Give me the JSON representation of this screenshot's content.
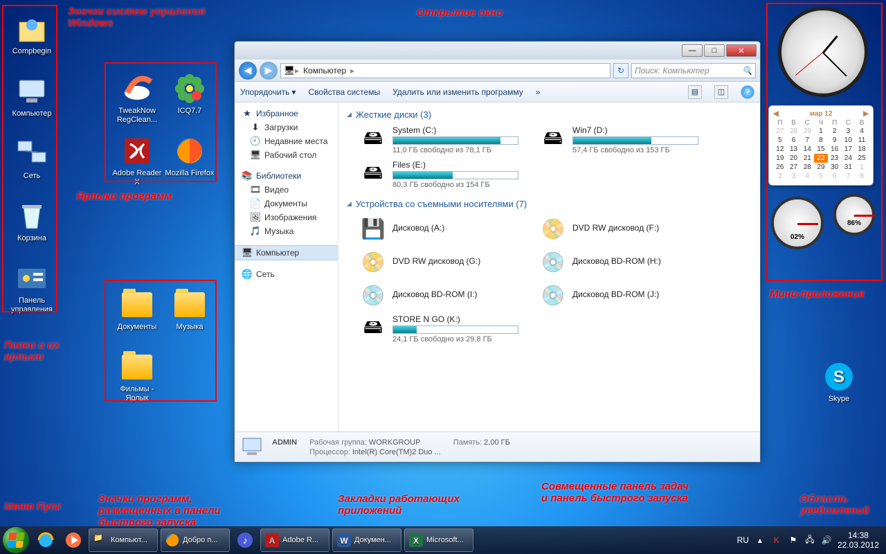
{
  "desktop_icons": {
    "compbegin": "Compbegin",
    "computer": "Компьютер",
    "network": "Сеть",
    "recycle": "Корзина",
    "cpanel": "Панель управления",
    "tweaknow": "TweakNow RegClean...",
    "icq": "ICQ7.7",
    "adobe": "Adobe Reader X",
    "firefox": "Mozilla Firefox",
    "documents": "Документы",
    "music": "Музыка",
    "films": "Фильмы - Ярлык",
    "skype": "Skype"
  },
  "callouts": {
    "system_icons": "Значки систем упраления Windows",
    "shortcuts": "Ярлыки программ",
    "folders": "Папки и их ярлыки",
    "start": "Меню Пуск",
    "quicklaunch": "Значки программ, размещенных в панели быстрого запуска",
    "open_window": "Открытое окно",
    "running_apps": "Закладки работающих приложений",
    "taskbar_combo": "Совмещенные панель задач и панель быстрого запуска",
    "gadgets": "Мини-приложения",
    "tray": "Область уведомлений"
  },
  "window": {
    "nav": {
      "back": "◀",
      "fwd": "▶"
    },
    "breadcrumb_root": "Компьютер",
    "refresh_icon": "↻",
    "search_placeholder": "Поиск: Компьютер",
    "toolbar": {
      "organize": "Упорядочить",
      "sysprops": "Свойства системы",
      "uninstall": "Удалить или изменить программу",
      "more": "»"
    },
    "sidebar": {
      "favorites": "Избранное",
      "downloads": "Загрузки",
      "recent": "Недавние места",
      "desktop": "Рабочий стол",
      "libraries": "Библиотеки",
      "video": "Видео",
      "documents": "Документы",
      "pictures": "Изображения",
      "music": "Музыка",
      "computer": "Компьютер",
      "network": "Сеть"
    },
    "sections": {
      "hdd": "Жесткие диски (3)",
      "removable": "Устройства со съемными носителями (7)"
    },
    "drives": {
      "system": {
        "name": "System (C:)",
        "free": "11,0 ГБ свободно из 78,1 ГБ",
        "pct": 86
      },
      "win7": {
        "name": "Win7 (D:)",
        "free": "57,4 ГБ свободно из 153 ГБ",
        "pct": 63
      },
      "files": {
        "name": "Files (E:)",
        "free": "80,3 ГБ свободно из 154 ГБ",
        "pct": 48
      },
      "floppy": {
        "name": "Дисковод (A:)"
      },
      "dvdrwF": {
        "name": "DVD RW дисковод (F:)"
      },
      "dvdrwG": {
        "name": "DVD RW дисковод (G:)"
      },
      "bdH": {
        "name": "Дисковод BD-ROM (H:)"
      },
      "bdI": {
        "name": "Дисковод BD-ROM (I:)"
      },
      "bdJ": {
        "name": "Дисковод BD-ROM (J:)"
      },
      "store": {
        "name": "STORE N GO (K:)",
        "free": "24,1 ГБ свободно из 29,8 ГБ",
        "pct": 19
      }
    },
    "status": {
      "user": "ADMIN",
      "workgroup_label": "Рабочая группа:",
      "workgroup": "WORKGROUP",
      "cpu_label": "Процессор:",
      "cpu": "Intel(R) Core(TM)2 Duo ...",
      "mem_label": "Память:",
      "mem": "2,00 ГБ"
    }
  },
  "calendar": {
    "month": "мар 12",
    "dow": [
      "П",
      "В",
      "С",
      "Ч",
      "П",
      "С",
      "В"
    ],
    "today": 22
  },
  "cpu_gadget": {
    "g1": "02%",
    "g2": "86%"
  },
  "taskbar": {
    "tasks": {
      "computer": "Компьют...",
      "welcome": "Добро п...",
      "adobe": "Adobe R...",
      "doc": "Докумен...",
      "excel": "Microsoft..."
    },
    "lang": "RU",
    "time": "14:38",
    "date": "22.03.2012"
  }
}
